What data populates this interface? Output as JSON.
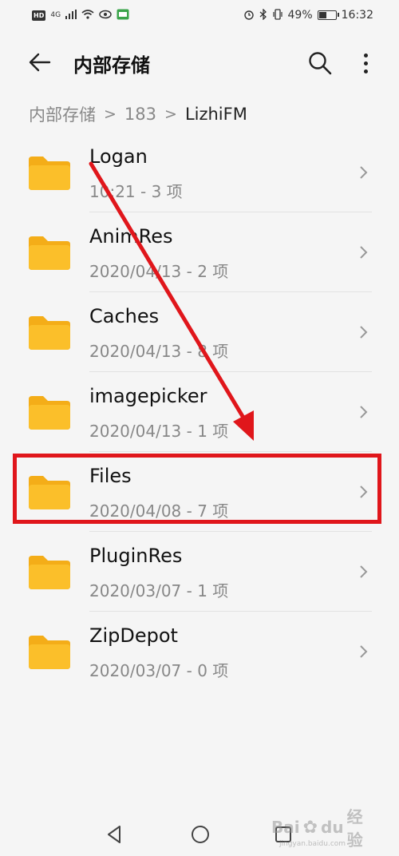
{
  "status_bar": {
    "left_badge": "HD",
    "network": "4G",
    "battery_percent": "49%",
    "battery_level": 0.49,
    "time": "16:32"
  },
  "app_bar": {
    "title": "内部存储",
    "icons": {
      "back": "arrow-left-icon",
      "search": "search-icon",
      "more": "more-vertical-icon"
    }
  },
  "breadcrumb": {
    "items": [
      "内部存储",
      "183",
      "LizhiFM"
    ],
    "separator": ">"
  },
  "files": [
    {
      "name": "Logan",
      "meta": "10:21 - 3 项"
    },
    {
      "name": "AnimRes",
      "meta": "2020/04/13 - 2 项"
    },
    {
      "name": "Caches",
      "meta": "2020/04/13 - 8 项"
    },
    {
      "name": "imagepicker",
      "meta": "2020/04/13 - 1 项"
    },
    {
      "name": "Files",
      "meta": "2020/04/08 - 7 项"
    },
    {
      "name": "PluginRes",
      "meta": "2020/03/07 - 1 项"
    },
    {
      "name": "ZipDepot",
      "meta": "2020/03/07 - 0 项"
    }
  ],
  "annotation": {
    "highlighted_item": "Files",
    "color": "#e0161b"
  },
  "colors": {
    "folder": "#fbbf2a",
    "folder_tab": "#f4ad18",
    "background": "#f5f5f5"
  },
  "watermark": {
    "brand": "Bai",
    "brand2": "du",
    "brand3": "经验",
    "url": "jingyan.baidu.com"
  }
}
